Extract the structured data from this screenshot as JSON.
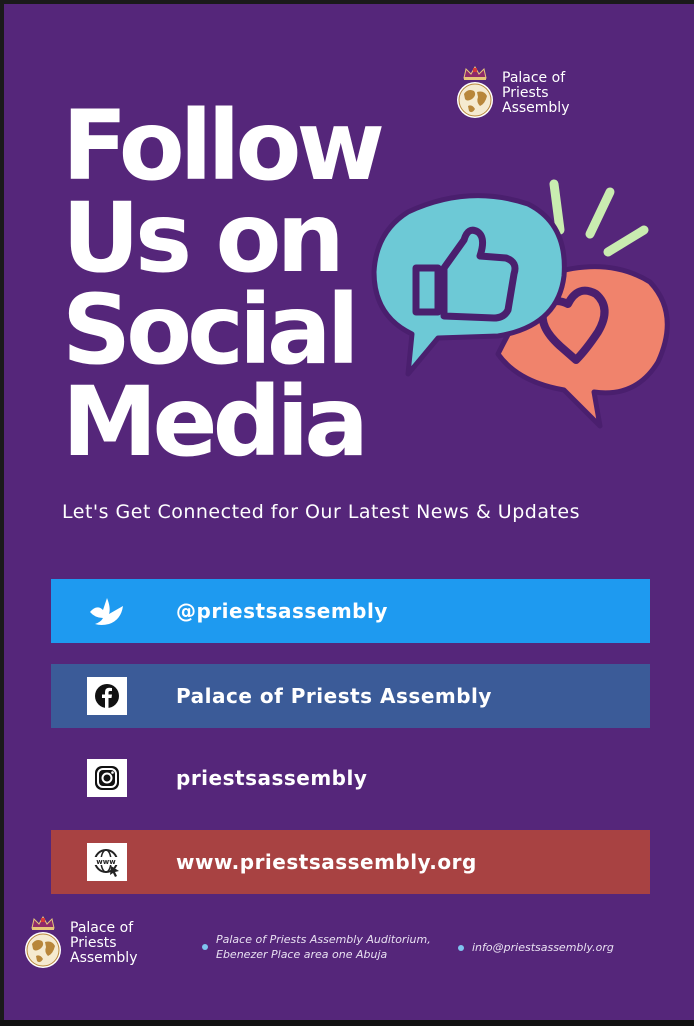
{
  "brand": {
    "line1": "Palace of",
    "line2": "Priests",
    "line3": "Assembly"
  },
  "headline": {
    "line1": "Follow",
    "line2": "Us on",
    "line3": "Social",
    "line4": "Media"
  },
  "tagline": "Let's Get Connected for Our Latest News & Updates",
  "social": [
    {
      "network": "twitter",
      "icon": "bird-icon",
      "label": "@priestsassembly",
      "color": "#1e9af0"
    },
    {
      "network": "facebook",
      "icon": "facebook-icon",
      "label": "Palace of Priests Assembly",
      "color": "#3b5b98"
    },
    {
      "network": "instagram",
      "icon": "instagram-icon",
      "label": "priestsassembly",
      "color": "#55267a"
    },
    {
      "network": "website",
      "icon": "www-globe-icon",
      "label": "www.priestsassembly.org",
      "color": "#a84242"
    }
  ],
  "contact": {
    "address_line1": "Palace of Priests Assembly Auditorium,",
    "address_line2": "Ebenezer Place area one Abuja",
    "email": "info@priestsassembly.org"
  },
  "colors": {
    "background": "#55267a",
    "bubble_like": "#6dc9d6",
    "bubble_heart": "#f0836c",
    "accent_lines": "#c9ecb0"
  }
}
